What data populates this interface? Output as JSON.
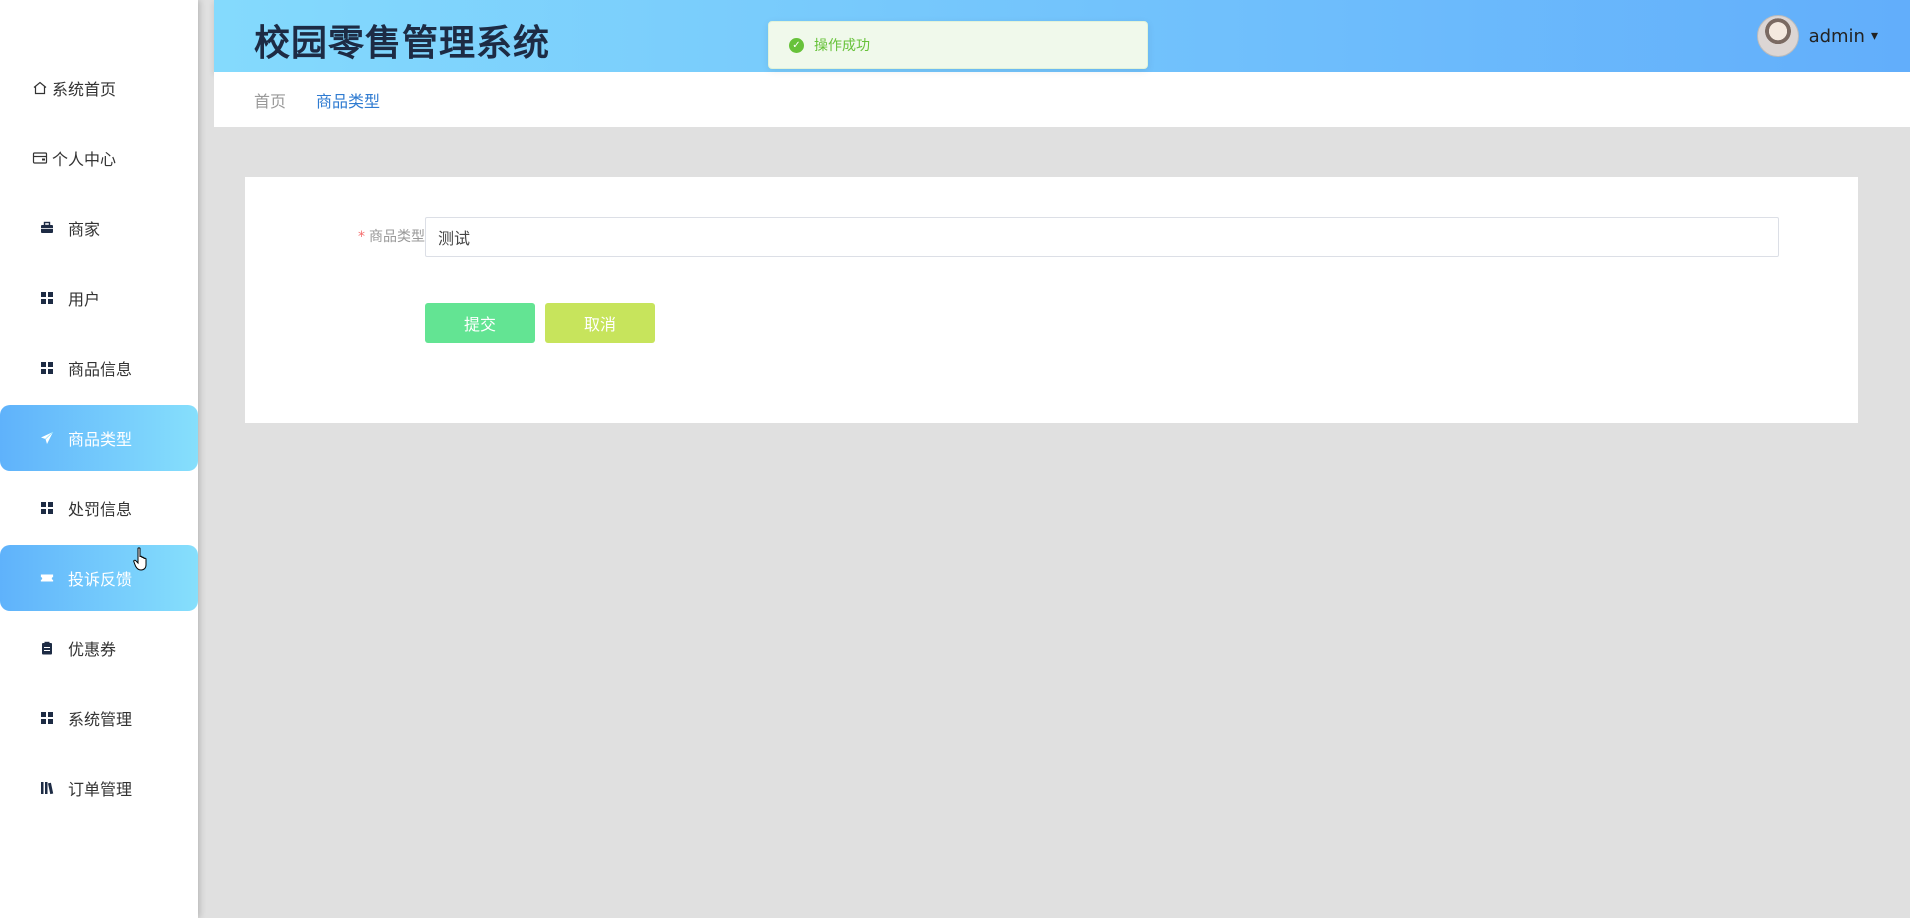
{
  "header": {
    "app_title": "校园零售管理系统",
    "username": "admin",
    "caret": "▾"
  },
  "toast": {
    "message": "操作成功",
    "check": "✓"
  },
  "sidebar": {
    "items": [
      {
        "label": "系统首页",
        "icon": "home-icon"
      },
      {
        "label": "个人中心",
        "icon": "wallet-icon"
      },
      {
        "label": "商家",
        "icon": "briefcase-icon"
      },
      {
        "label": "用户",
        "icon": "grid-icon"
      },
      {
        "label": "商品信息",
        "icon": "grid-icon"
      },
      {
        "label": "商品类型",
        "icon": "paper-plane-icon",
        "active": true
      },
      {
        "label": "处罚信息",
        "icon": "grid-icon"
      },
      {
        "label": "投诉反馈",
        "icon": "ticket-icon",
        "active": true
      },
      {
        "label": "优惠券",
        "icon": "clipboard-icon"
      },
      {
        "label": "系统管理",
        "icon": "grid-icon"
      },
      {
        "label": "订单管理",
        "icon": "library-icon"
      }
    ]
  },
  "breadcrumb": {
    "home": "首页",
    "current": "商品类型"
  },
  "form": {
    "required_mark": "*",
    "field_label": "商品类型",
    "field_value": "测试",
    "submit_label": "提交",
    "cancel_label": "取消"
  },
  "colors": {
    "header_gradient_start": "#84dafd",
    "header_gradient_end": "#62aefb",
    "active_menu_start": "#5fb2fb",
    "active_menu_end": "#86dffc",
    "submit_button": "#63e493",
    "cancel_button": "#c7e45c",
    "toast_text": "#67c23a"
  }
}
